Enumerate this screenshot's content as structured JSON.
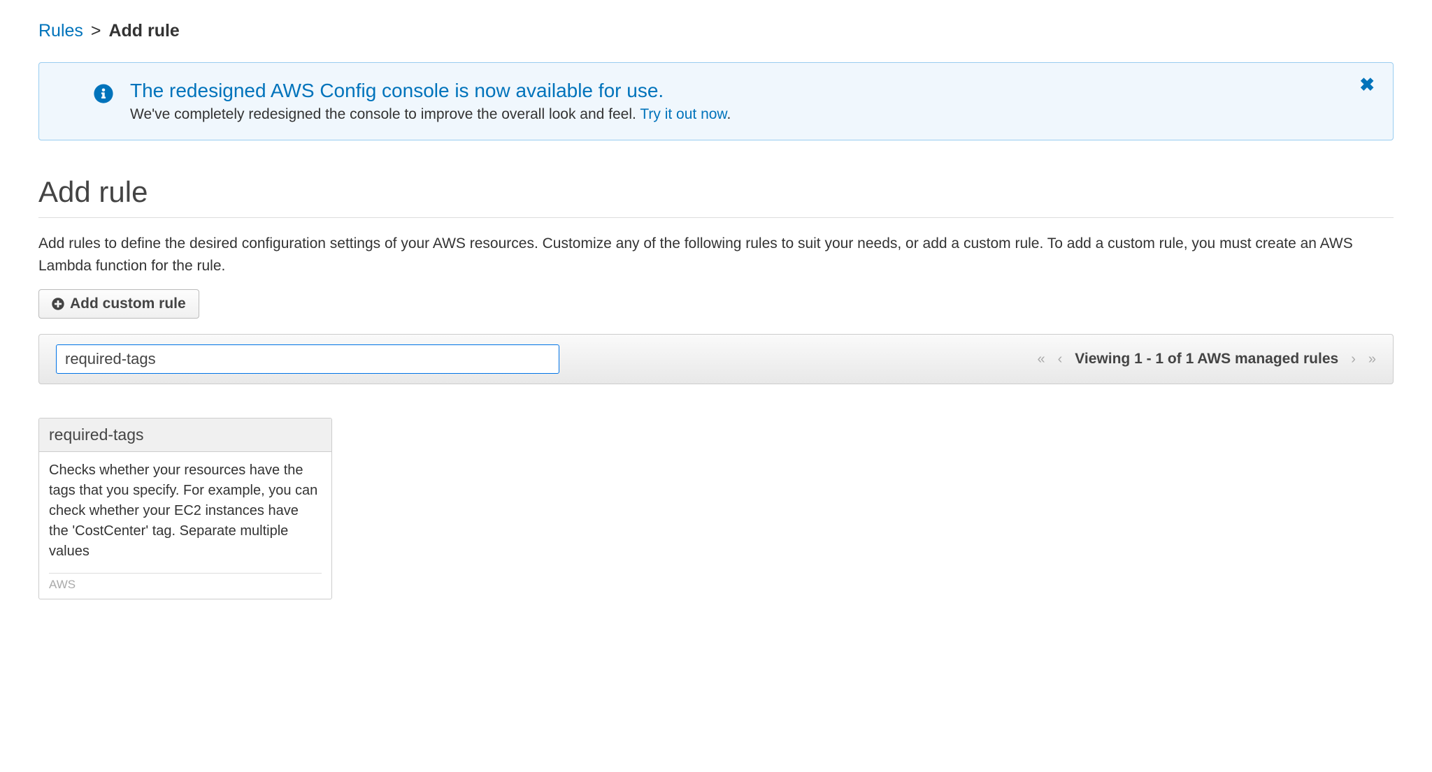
{
  "breadcrumb": {
    "root": "Rules",
    "current": "Add rule"
  },
  "banner": {
    "title": "The redesigned AWS Config console is now available for use.",
    "body_prefix": "We've completely redesigned the console to improve the overall look and feel. ",
    "link_text": "Try it out now",
    "body_suffix": "."
  },
  "page": {
    "title": "Add rule",
    "description": "Add rules to define the desired configuration settings of your AWS resources. Customize any of the following rules to suit your needs, or add a custom rule. To add a custom rule, you must create an AWS Lambda function for the rule."
  },
  "buttons": {
    "add_custom_rule": "Add custom rule"
  },
  "search": {
    "value": "required-tags"
  },
  "pagination": {
    "text": "Viewing 1 - 1 of 1 AWS managed rules"
  },
  "rule_card": {
    "name": "required-tags",
    "description": "Checks whether your resources have the tags that you specify. For example, you can check whether your EC2 instances have the 'CostCenter' tag. Separate multiple values",
    "source": "AWS"
  }
}
